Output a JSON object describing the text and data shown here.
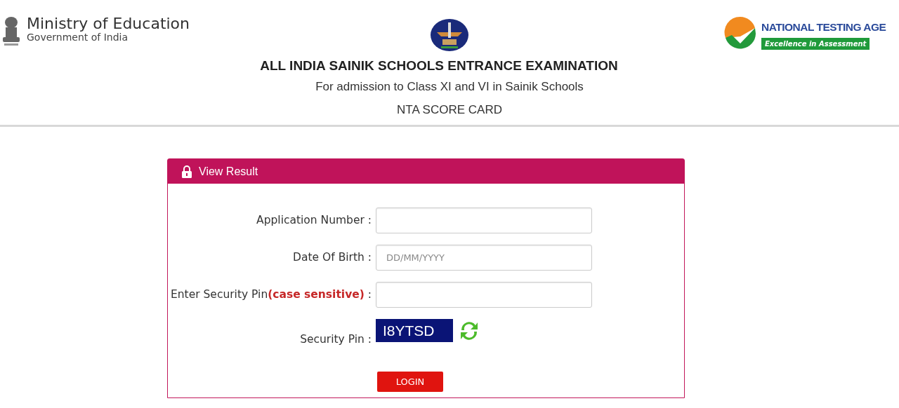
{
  "header": {
    "ministry": {
      "title": "Ministry of Education",
      "subtitle": "Government of India"
    },
    "exam": {
      "title": "ALL INDIA SAINIK SCHOOLS ENTRANCE EXAMINATION",
      "subtitle": "For admission to Class XI and VI in Sainik Schools",
      "card": "NTA SCORE CARD"
    },
    "agency": {
      "title": "NATIONAL TESTING AGE",
      "tagline": "Excellence in Assessment"
    }
  },
  "form": {
    "title": "View Result",
    "fields": [
      {
        "kind": "input",
        "label": "Application Number :"
      },
      {
        "kind": "input",
        "label": "Date Of Birth :",
        "placeholder": "DD/MM/YYYY"
      },
      {
        "kind": "input",
        "label": "Enter Security Pin**(case sensitive)** :"
      },
      {
        "kind": "captcha",
        "label": "Security Pin :",
        "value": "I8YTSD"
      }
    ],
    "button": "LOGIN"
  }
}
